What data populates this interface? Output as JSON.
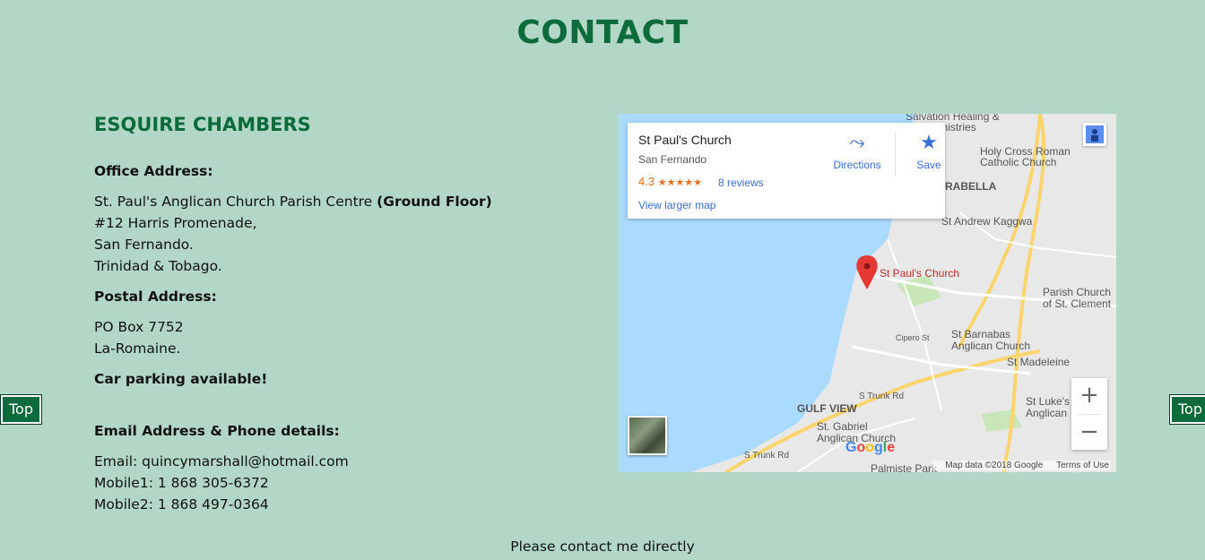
{
  "page": {
    "title": "CONTACT",
    "top_label": "Top",
    "footer": "Please contact me directly"
  },
  "firm": {
    "name": "ESQUIRE CHAMBERS",
    "office_heading": "Office Address:",
    "office_line1": "St. Paul's Anglican Church Parish Centre",
    "office_line1_bold": "(Ground Floor)",
    "office_line2": "#12 Harris Promenade,",
    "office_line3": "San Fernando.",
    "office_line4": "Trinidad & Tobago.",
    "postal_heading": "Postal Address:",
    "postal_line1": "PO Box 7752",
    "postal_line2": "La-Romaine.",
    "parking": "Car parking available!",
    "contact_heading": "Email Address & Phone details:",
    "email": "Email: quincymarshall@hotmail.com",
    "mobile1": "Mobile1: 1 868 305-6372",
    "mobile2": "Mobile2: 1 868 497-0364"
  },
  "map": {
    "place_name": "St Paul's Church",
    "place_sub": "San Fernando",
    "rating": "4.3",
    "stars": "★★★★★",
    "reviews": "8 reviews",
    "directions": "Directions",
    "save": "Save",
    "view_larger": "View larger map",
    "marker_label": "St Paul's Church",
    "labels": {
      "salvation": "Salvation Healing &",
      "ministries": "Ministries",
      "holy_cross1": "Holy Cross Roman",
      "holy_cross2": "Catholic Church",
      "arabella": "RABELLA",
      "st_andrew": "St Andrew Kaggwa",
      "parish1": "Parish Church",
      "parish2": "of St. Clement",
      "barnabas1": "St Barnabas",
      "barnabas2": "Anglican Church",
      "madeleine": "St Madeleine",
      "gulf_view": "GULF VIEW",
      "s_trunk1": "S Trunk Rd",
      "s_trunk2": "S Trunk Rd",
      "gabriel1": "St. Gabriel",
      "gabriel2": "Anglican Church",
      "luke1": "St Luke's",
      "luke2": "Anglican",
      "palmiste": "Palmiste Park",
      "cipero": "Cipero St"
    },
    "google": "Google",
    "map_data": "Map data ©2018 Google",
    "terms": "Terms of Use",
    "zoom_in": "+",
    "zoom_out": "−"
  }
}
